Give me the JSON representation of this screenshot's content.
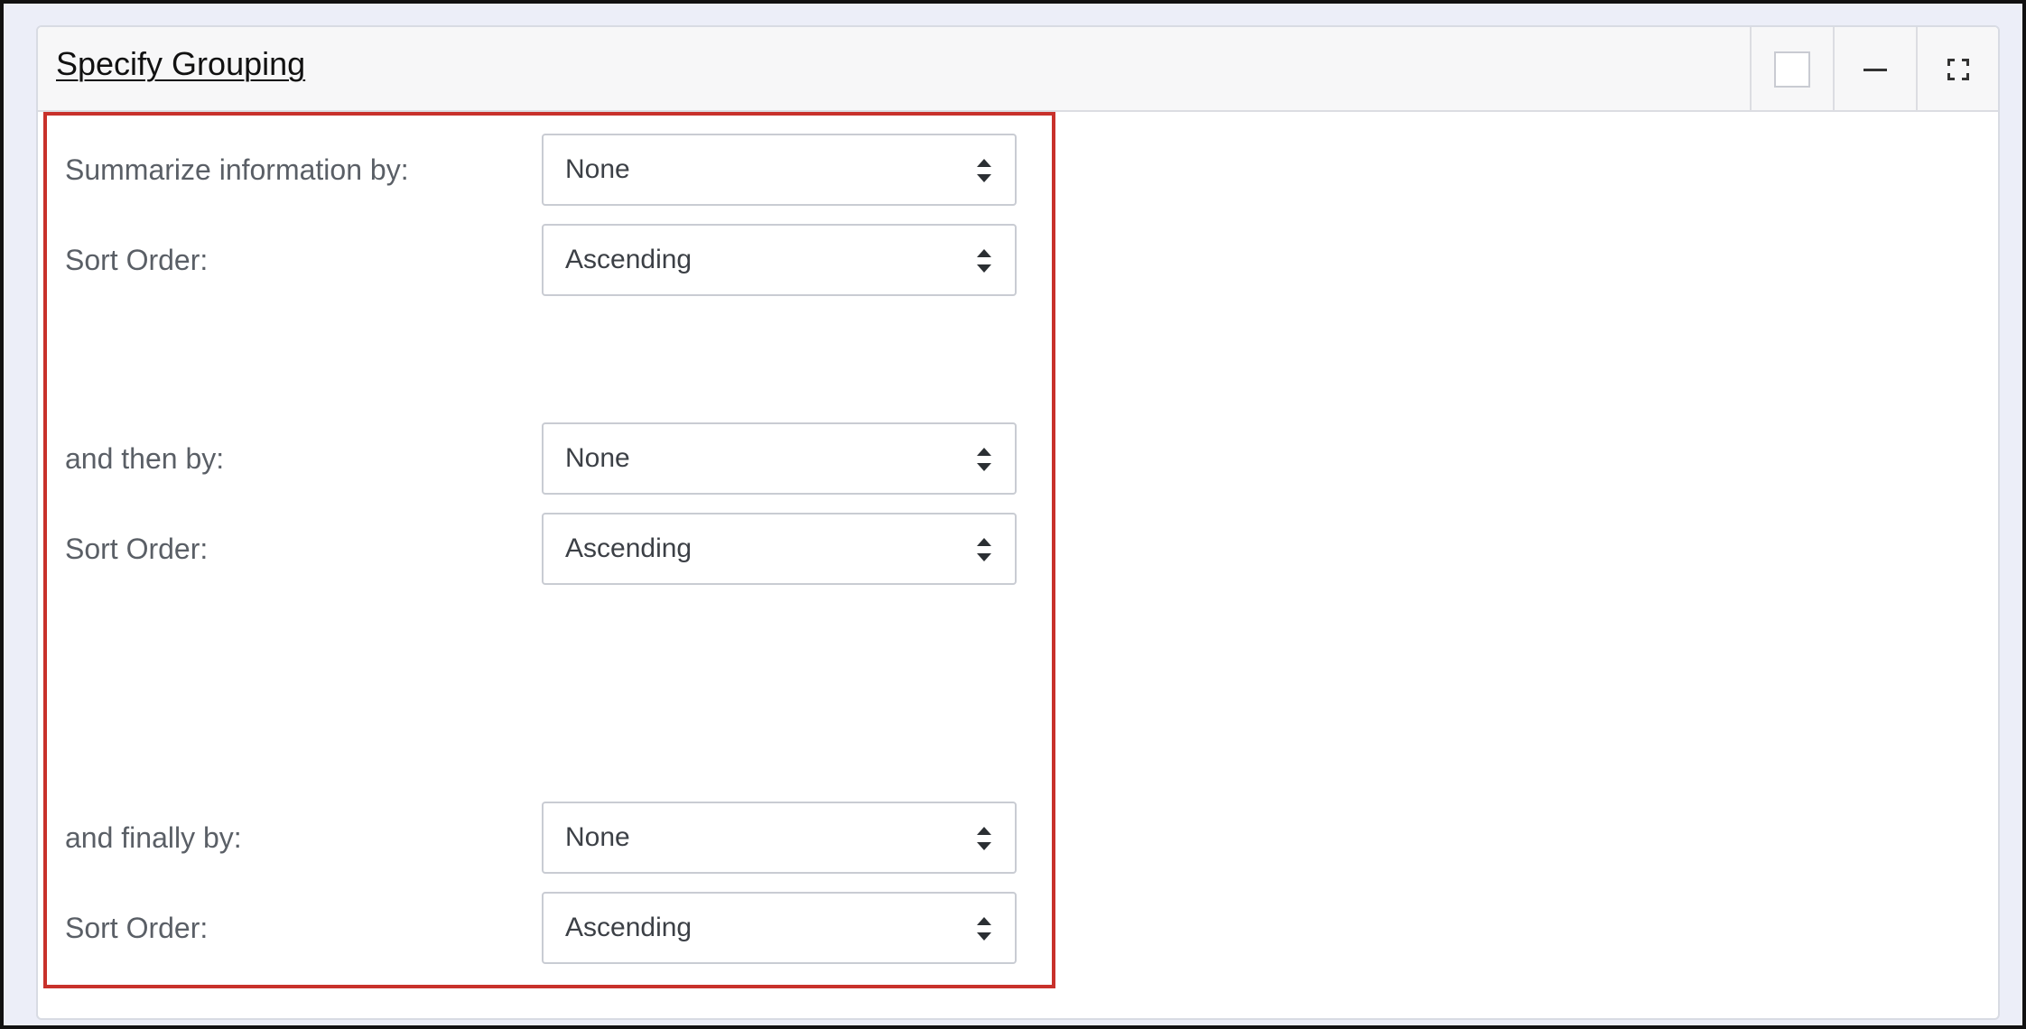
{
  "panel": {
    "title": "Specify Grouping",
    "controls": [
      {
        "icon": "checkbox-icon"
      },
      {
        "icon": "minimize-icon"
      },
      {
        "icon": "fullscreen-icon"
      }
    ]
  },
  "grouping": {
    "rows": [
      {
        "label": "Summarize information by:",
        "value": "None"
      },
      {
        "label": "Sort Order:",
        "value": "Ascending"
      },
      {
        "label": "and then by:",
        "value": "None"
      },
      {
        "label": "Sort Order:",
        "value": "Ascending"
      },
      {
        "label": "and finally by:",
        "value": "None"
      },
      {
        "label": "Sort Order:",
        "value": "Ascending"
      }
    ]
  },
  "colors": {
    "highlight_border": "#c8312b",
    "label_text": "#5a5f66",
    "header_bg": "#f7f7f8"
  }
}
